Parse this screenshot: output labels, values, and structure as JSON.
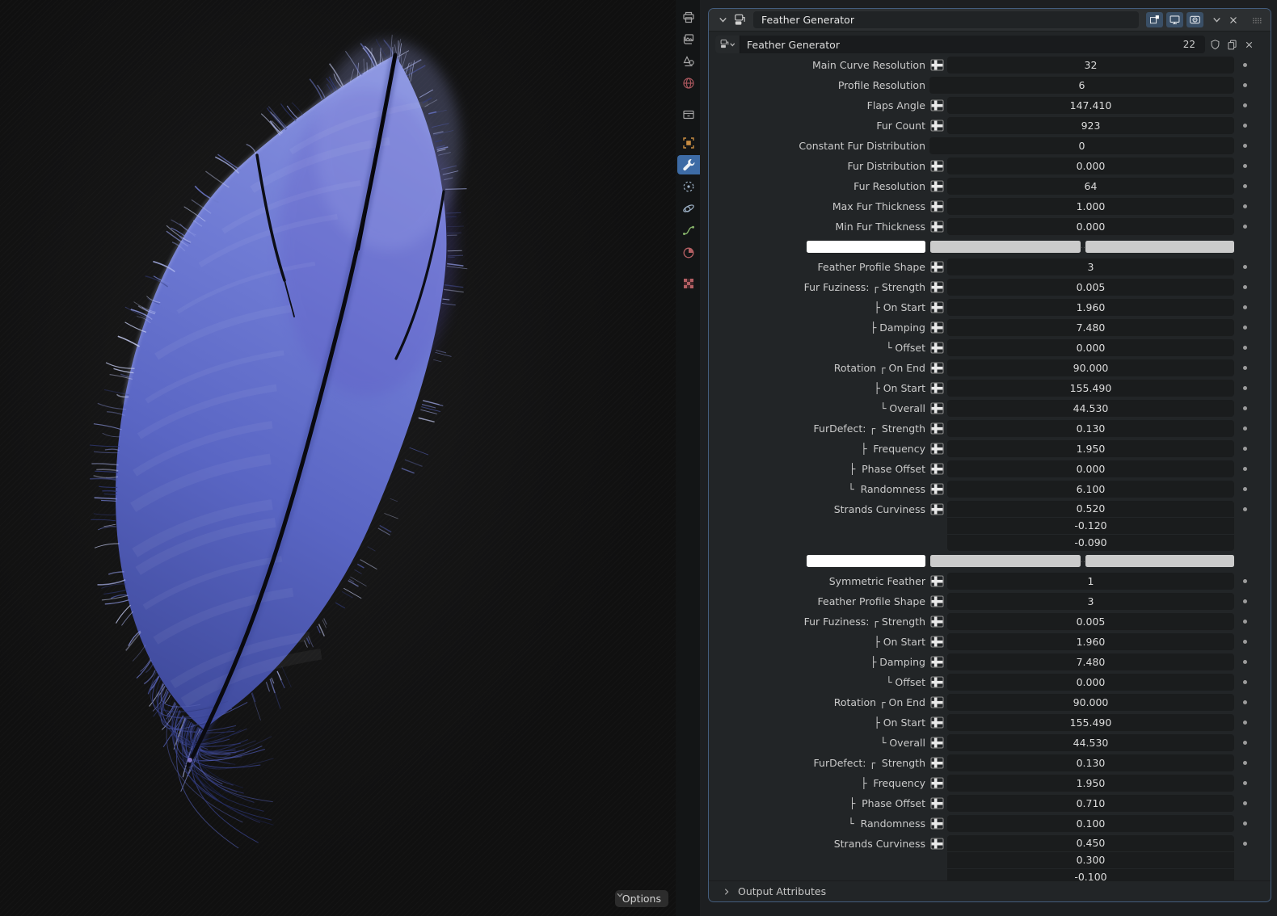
{
  "window": {
    "options_label": "Options"
  },
  "viewport": {
    "render_subject": "blue feather render"
  },
  "properties_editor": {
    "tabs": [
      {
        "name": "output",
        "icon": "printer-icon",
        "active": false
      },
      {
        "name": "view-layer",
        "icon": "images-icon",
        "active": false
      },
      {
        "name": "scene",
        "icon": "scene-icon",
        "active": false
      },
      {
        "name": "world",
        "icon": "world-icon",
        "active": false
      },
      {
        "name": "collection",
        "icon": "collection-icon",
        "active": false
      },
      {
        "name": "object",
        "icon": "object-icon",
        "active": false
      },
      {
        "name": "modifiers",
        "icon": "wrench-icon",
        "active": true
      },
      {
        "name": "particles",
        "icon": "particles-icon",
        "active": false
      },
      {
        "name": "physics",
        "icon": "physics-icon",
        "active": false
      },
      {
        "name": "object-data",
        "icon": "curve-data-icon",
        "active": false
      },
      {
        "name": "material",
        "icon": "material-icon",
        "active": false
      },
      {
        "name": "texture",
        "icon": "texture-icon",
        "active": false
      }
    ],
    "modifier_panel": {
      "title": "Feather Generator",
      "node_group_name": "Feather Generator",
      "users_count": "22",
      "output_attributes_label": "Output Attributes",
      "swatch_colors": [
        "#ffffff",
        "#cbcbcb",
        "#cbcbcb"
      ],
      "rows": [
        {
          "type": "field",
          "label": "Main Curve Resolution",
          "value": "32",
          "attr_toggle": true
        },
        {
          "type": "field",
          "label": "Profile Resolution",
          "value": "6",
          "attr_toggle": false
        },
        {
          "type": "field",
          "label": "Flaps Angle",
          "value": "147.410",
          "attr_toggle": true
        },
        {
          "type": "field",
          "label": "Fur Count",
          "value": "923",
          "attr_toggle": true
        },
        {
          "type": "field",
          "label": "Constant Fur Distribution",
          "value": "0",
          "attr_toggle": false
        },
        {
          "type": "field",
          "label": "Fur Distribution",
          "value": "0.000",
          "attr_toggle": true
        },
        {
          "type": "field",
          "label": "Fur Resolution",
          "value": "64",
          "attr_toggle": true
        },
        {
          "type": "field",
          "label": "Max Fur Thickness",
          "value": "1.000",
          "attr_toggle": true
        },
        {
          "type": "field",
          "label": "Min Fur Thickness",
          "value": "0.000",
          "attr_toggle": true
        },
        {
          "type": "swatches"
        },
        {
          "type": "field",
          "label": "Feather Profile Shape",
          "value": "3",
          "attr_toggle": true
        },
        {
          "type": "field",
          "label": "Fur Fuziness: ┌ Strength",
          "value": "0.005",
          "attr_toggle": true
        },
        {
          "type": "field",
          "label": "├ On Start",
          "value": "1.960",
          "attr_toggle": true
        },
        {
          "type": "field",
          "label": "├ Damping",
          "value": "7.480",
          "attr_toggle": true
        },
        {
          "type": "field",
          "label": "└ Offset",
          "value": "0.000",
          "attr_toggle": true
        },
        {
          "type": "field",
          "label": "Rotation ┌ On End",
          "value": "90.000",
          "attr_toggle": true
        },
        {
          "type": "field",
          "label": "├ On Start",
          "value": "155.490",
          "attr_toggle": true
        },
        {
          "type": "field",
          "label": "└ Overall",
          "value": "44.530",
          "attr_toggle": true
        },
        {
          "type": "field",
          "label": "FurDefect: ┌  Strength",
          "value": "0.130",
          "attr_toggle": true
        },
        {
          "type": "field",
          "label": "├  Frequency",
          "value": "1.950",
          "attr_toggle": true
        },
        {
          "type": "field",
          "label": "├  Phase Offset",
          "value": "0.000",
          "attr_toggle": true
        },
        {
          "type": "field",
          "label": "└  Randomness",
          "value": "6.100",
          "attr_toggle": true
        },
        {
          "type": "vector",
          "label": "Strands Curviness",
          "values": [
            "0.520",
            "-0.120",
            "-0.090"
          ],
          "attr_toggle": true
        },
        {
          "type": "swatches"
        },
        {
          "type": "field",
          "label": "Symmetric Feather",
          "value": "1",
          "attr_toggle": true
        },
        {
          "type": "field",
          "label": "Feather Profile Shape",
          "value": "3",
          "attr_toggle": true
        },
        {
          "type": "field",
          "label": "Fur Fuziness: ┌ Strength",
          "value": "0.005",
          "attr_toggle": true
        },
        {
          "type": "field",
          "label": "├ On Start",
          "value": "1.960",
          "attr_toggle": true
        },
        {
          "type": "field",
          "label": "├ Damping",
          "value": "7.480",
          "attr_toggle": true
        },
        {
          "type": "field",
          "label": "└ Offset",
          "value": "0.000",
          "attr_toggle": true
        },
        {
          "type": "field",
          "label": "Rotation ┌ On End",
          "value": "90.000",
          "attr_toggle": true
        },
        {
          "type": "field",
          "label": "├ On Start",
          "value": "155.490",
          "attr_toggle": true
        },
        {
          "type": "field",
          "label": "└ Overall",
          "value": "44.530",
          "attr_toggle": true
        },
        {
          "type": "field",
          "label": "FurDefect: ┌  Strength",
          "value": "0.130",
          "attr_toggle": true
        },
        {
          "type": "field",
          "label": "├  Frequency",
          "value": "1.950",
          "attr_toggle": true
        },
        {
          "type": "field",
          "label": "├  Phase Offset",
          "value": "0.710",
          "attr_toggle": true
        },
        {
          "type": "field",
          "label": "└  Randomness",
          "value": "0.100",
          "attr_toggle": true
        },
        {
          "type": "vector",
          "label": "Strands Curviness",
          "values": [
            "0.450",
            "0.300",
            "-0.100"
          ],
          "attr_toggle": true
        }
      ]
    }
  },
  "colors": {
    "accent_blue": "#3d6ba5",
    "panel_outline": "#5a7fb0",
    "decorator_dot": "#9c9c9c",
    "feather_primary": "#6e7ad4",
    "object_orange": "#c88c42",
    "world_red": "#a8565d",
    "material_red": "#b35f63",
    "data_green": "#86b36a"
  }
}
